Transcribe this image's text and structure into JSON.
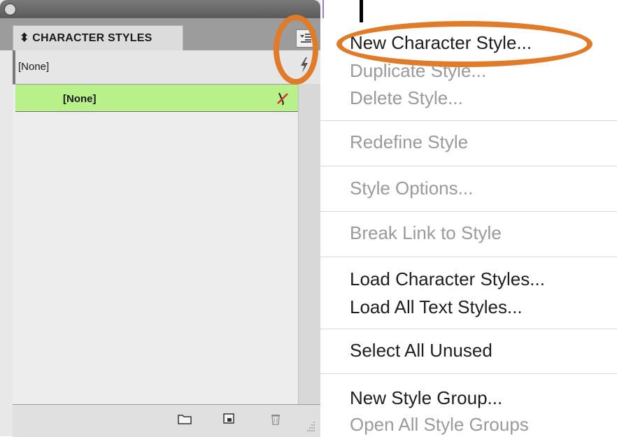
{
  "panel": {
    "tab_label": "⬍ CHARACTER STYLES",
    "current_style": "[None]",
    "list_items": [
      {
        "label": "[None]"
      }
    ]
  },
  "menu": {
    "items": [
      {
        "label": "New Character Style...",
        "enabled": true
      },
      {
        "label": "Duplicate Style...",
        "enabled": false
      },
      {
        "label": "Delete Style...",
        "enabled": false
      },
      {
        "label": "Redefine Style",
        "enabled": false
      },
      {
        "label": "Style Options...",
        "enabled": false
      },
      {
        "label": "Break Link to Style",
        "enabled": false
      },
      {
        "label": "Load Character Styles...",
        "enabled": true
      },
      {
        "label": "Load All Text Styles...",
        "enabled": true
      },
      {
        "label": "Select All Unused",
        "enabled": true
      },
      {
        "label": "New Style Group...",
        "enabled": true
      },
      {
        "label": "Open All Style Groups",
        "enabled": false
      }
    ]
  },
  "colors": {
    "highlight_ring": "#e07b2a",
    "selected_row": "#b8f08a",
    "disabled_text": "#9a9a9a"
  },
  "icons": {
    "panel_menu": "panel-menu-icon",
    "lightning": "lightning-icon",
    "no_edit": "no-edit-pencil-icon",
    "new_group": "folder-icon",
    "new_style": "new-style-icon",
    "delete": "trash-icon"
  }
}
